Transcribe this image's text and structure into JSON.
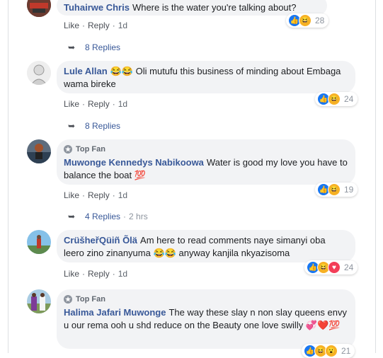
{
  "actions": {
    "like": "Like",
    "reply": "Reply",
    "sep": "·"
  },
  "comments": [
    {
      "author": "Tuhairwe Chris",
      "text": "Where is the water you're talking about?",
      "time": "1d",
      "reaction_count": "28",
      "replies": "8 Replies"
    },
    {
      "author": "Lule Allan",
      "emoji": "😂😂",
      "text": "Oli mutufu this business of minding about Embaga wama bireke",
      "time": "1d",
      "reaction_count": "24",
      "replies": "8 Replies"
    },
    {
      "badge": "Top Fan",
      "author": "Muwonge Kennedys Nabikoowa",
      "text": "Water is good my love you have to balance the boat",
      "emoji_end": "💯",
      "time": "1d",
      "reaction_count": "19",
      "replies": "4 Replies",
      "replies_time": "2 hrs"
    },
    {
      "author": "CrüšheřQüiñ Õlä",
      "text": "Am here to read comments naye simanyi oba leero zino zinanyuma",
      "emoji_mid": "😂😂",
      "text2": "anyway kanjila nkyazisoma",
      "time": "1d",
      "reaction_count": "24"
    },
    {
      "badge": "Top Fan",
      "author": "Halima Jafari Muwonge",
      "text": "The way these slay n non slay queens envy u our rema ooh u shd reduce on the Beauty one love swilly",
      "emoji_end": "💞❤️💯",
      "reaction_count": "21"
    }
  ],
  "icons": {
    "like": "thumbs-up",
    "haha": "laugh",
    "love": "heart",
    "badge": "star"
  }
}
